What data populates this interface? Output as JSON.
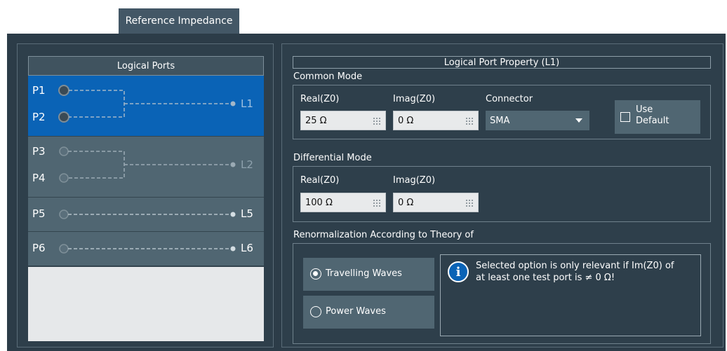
{
  "tab": {
    "label": "Reference Impedance"
  },
  "logical_ports": {
    "header": "Logical Ports",
    "rows": [
      {
        "ports": [
          "P1",
          "P2"
        ],
        "logical": "L1",
        "selected": true
      },
      {
        "ports": [
          "P3",
          "P4"
        ],
        "logical": "L2",
        "selected": false
      },
      {
        "ports": [
          "P5"
        ],
        "logical": "L5",
        "selected": false
      },
      {
        "ports": [
          "P6"
        ],
        "logical": "L6",
        "selected": false
      }
    ]
  },
  "property": {
    "title": "Logical Port Property (L1)",
    "common_mode": {
      "label": "Common Mode",
      "real_label": "Real(Z0)",
      "real_value": "25 Ω",
      "imag_label": "Imag(Z0)",
      "imag_value": "0 Ω",
      "connector_label": "Connector",
      "connector_value": "SMA",
      "use_default_line1": "Use",
      "use_default_line2": "Default",
      "use_default_checked": false
    },
    "differential_mode": {
      "label": "Differential Mode",
      "real_label": "Real(Z0)",
      "real_value": "100 Ω",
      "imag_label": "Imag(Z0)",
      "imag_value": "0 Ω"
    },
    "renormalization": {
      "label": "Renormalization According to Theory of",
      "options": [
        {
          "label": "Travelling Waves",
          "checked": true
        },
        {
          "label": "Power Waves",
          "checked": false
        }
      ],
      "info_line1": "Selected option is only relevant if Im(Z0) of",
      "info_line2": "at least one test port is ≠ 0 Ω!"
    }
  },
  "colors": {
    "accent": "#0a63b6",
    "panel_bg": "#2c3c48",
    "button_bg": "#506672"
  }
}
